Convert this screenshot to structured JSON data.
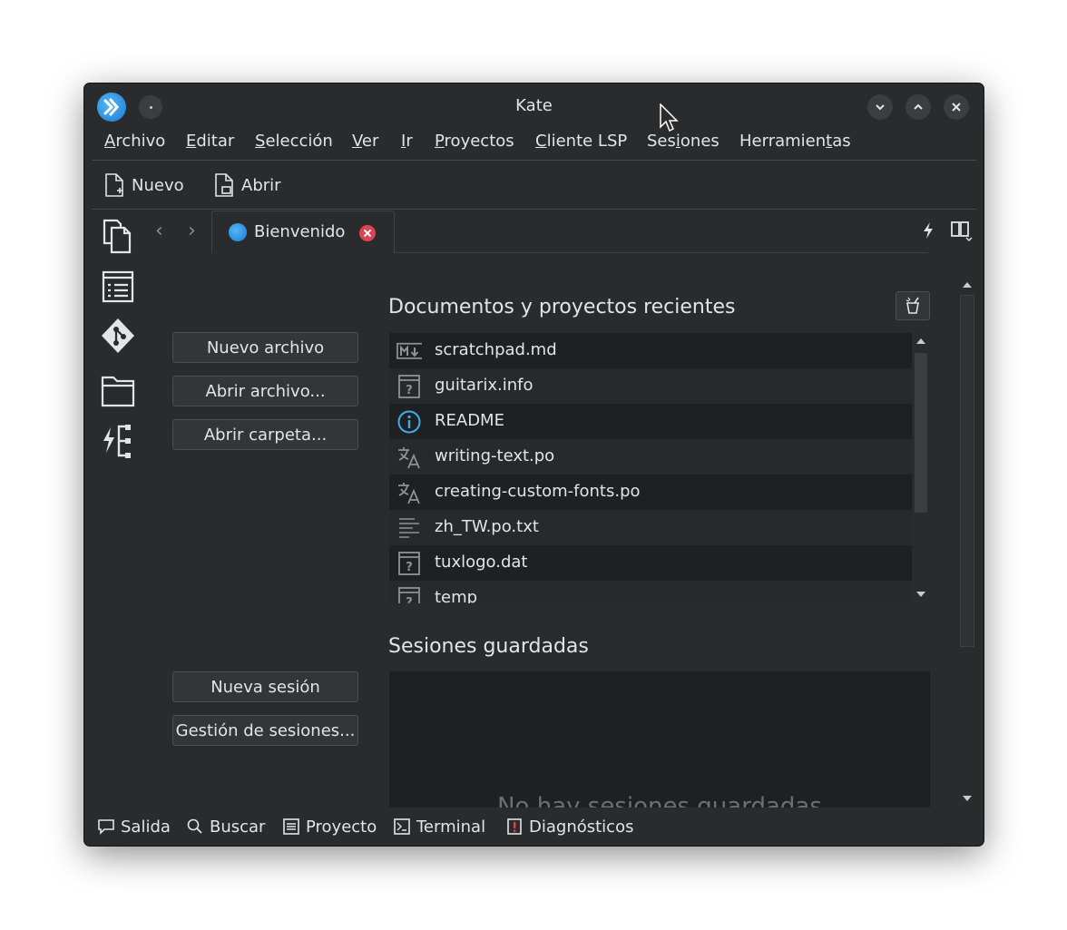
{
  "window": {
    "title": "Kate"
  },
  "menu": [
    {
      "label": "Archivo",
      "ul": "A",
      "rest": "rchivo"
    },
    {
      "label": "Editar",
      "ul": "E",
      "rest": "ditar"
    },
    {
      "label": "Selección",
      "ul": "S",
      "rest": "elección"
    },
    {
      "label": "Ver",
      "ul": "V",
      "rest": "er"
    },
    {
      "label": "Ir",
      "ul": "I",
      "rest": "r"
    },
    {
      "label": "Proyectos",
      "ul": "P",
      "rest": "royectos"
    },
    {
      "label": "Cliente LSP",
      "ul": "C",
      "rest": "liente LSP"
    },
    {
      "label": "Sesiones",
      "pre": "Ses",
      "ul": "i",
      "rest": "ones"
    },
    {
      "label": "Herramientas",
      "pre": "Herramien",
      "ul": "t",
      "rest": "as"
    }
  ],
  "toolbar": {
    "new_label": "Nuevo",
    "open_label": "Abrir"
  },
  "tabs": {
    "active_label": "Bienvenido"
  },
  "welcome": {
    "new_file": "Nuevo archivo",
    "open_file": "Abrir archivo...",
    "open_folder": "Abrir carpeta...",
    "new_session": "Nueva sesión",
    "manage_sessions": "Gestión de sesiones..."
  },
  "recent": {
    "title": "Documentos y proyectos recientes",
    "items": [
      {
        "name": "scratchpad.md",
        "icon": "markdown-icon"
      },
      {
        "name": "guitarix.info",
        "icon": "unknown-file-icon"
      },
      {
        "name": "README",
        "icon": "info-icon"
      },
      {
        "name": "writing-text.po",
        "icon": "translation-icon"
      },
      {
        "name": "creating-custom-fonts.po",
        "icon": "translation-icon"
      },
      {
        "name": "zh_TW.po.txt",
        "icon": "text-file-icon"
      },
      {
        "name": "tuxlogo.dat",
        "icon": "unknown-file-icon"
      },
      {
        "name": "temp",
        "icon": "unknown-file-icon"
      }
    ]
  },
  "sessions": {
    "title": "Sesiones guardadas",
    "empty_message": "No hay sesiones guardadas"
  },
  "statusbar": {
    "output": "Salida",
    "search": "Buscar",
    "project": "Proyecto",
    "terminal": "Terminal",
    "diagnostics": "Diagnósticos"
  },
  "colors": {
    "background": "#2a2b2d",
    "list_bg": "#1f2021",
    "text": "#e3e4e6",
    "close_red": "#da4453",
    "info_blue": "#3daee9"
  }
}
